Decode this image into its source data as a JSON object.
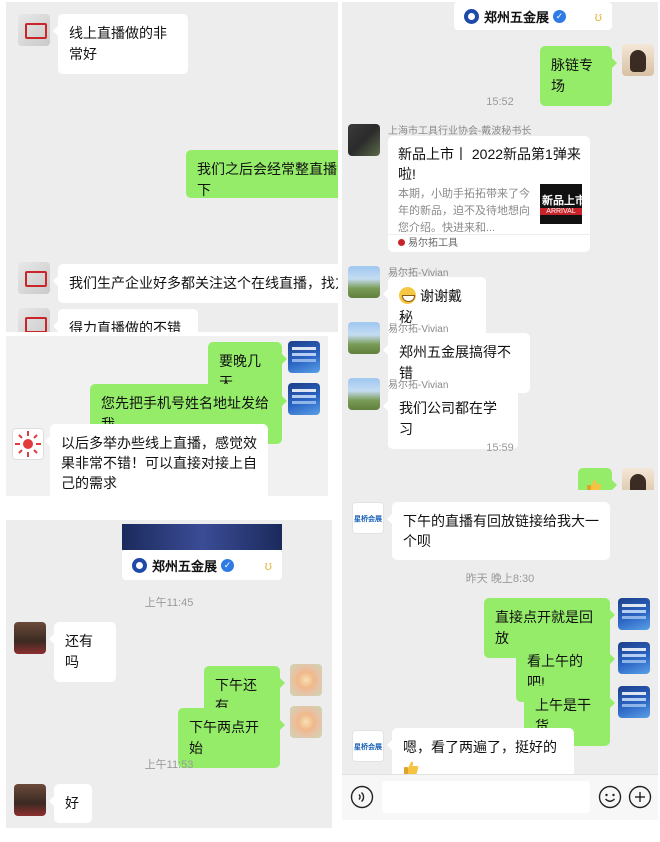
{
  "left_top": {
    "messages": [
      {
        "text": "线上直播做的非常好"
      },
      {
        "text": "我们之后会经常整直播活动"
      },
      {
        "text": "下"
      },
      {
        "text": "我们生产企业好多都关注这个在线直播，找方向"
      },
      {
        "text": "得力直播做的不错"
      }
    ]
  },
  "left_mid": {
    "messages": [
      {
        "text": "要晚几天"
      },
      {
        "text": "您先把手机号姓名地址发给我"
      },
      {
        "text": "以后多举办些线上直播，感觉效果非常不错！可以直接对接上自己的需求"
      }
    ]
  },
  "left_bottom": {
    "card_title": "郑州五金展",
    "card_verified_icon": "verified-badge-icon",
    "ts1": "上午11:45",
    "msg_haiyouma": "还有吗",
    "msg_xiawu": "下午还有",
    "msg_liangdian": "下午两点开始",
    "ts2": "上午11:53",
    "msg_hao": "好"
  },
  "right_top": {
    "card_title": "郑州五金展",
    "msg_mailian": "脉链专场",
    "ts1": "15:52",
    "sender1": "上海市工具行业协会-戴波秘书长",
    "article_title": "新品上市丨 2022新品第1弹来啦!",
    "article_desc": "本期，小助手拓拓带来了今年的新品，迫不及待地想向您介绍。快进来和...",
    "article_thumb_text": "新品上市",
    "article_thumb_sub": "ARRIVAL",
    "article_source": "易尔拓工具",
    "sender2": "易尔拓-Vivian",
    "msg_xiexie": "谢谢戴秘",
    "sender3": "易尔拓-Vivian",
    "msg_gaode": "郑州五金展搞得不错",
    "sender4": "易尔拓-Vivian",
    "msg_xuexi": "我们公司都在学习",
    "ts2": "15:59"
  },
  "right_bottom": {
    "msg_huifang_q": "下午的直播有回放链接给我大一个呗",
    "ts": "昨天 晚上8:30",
    "msg_huifang_a": "直接点开就是回放",
    "msg_shangwu": "看上午的吧!",
    "msg_gan": "上午是干货",
    "msg_kanle": "嗯，看了两遍了，挺好的",
    "xingqiao_logo": "星桥会展",
    "input_placeholder": ""
  },
  "colors": {
    "green_bubble": "#95ec69",
    "panel_bg": "#ededed",
    "timestamp": "#9a9a9a"
  }
}
